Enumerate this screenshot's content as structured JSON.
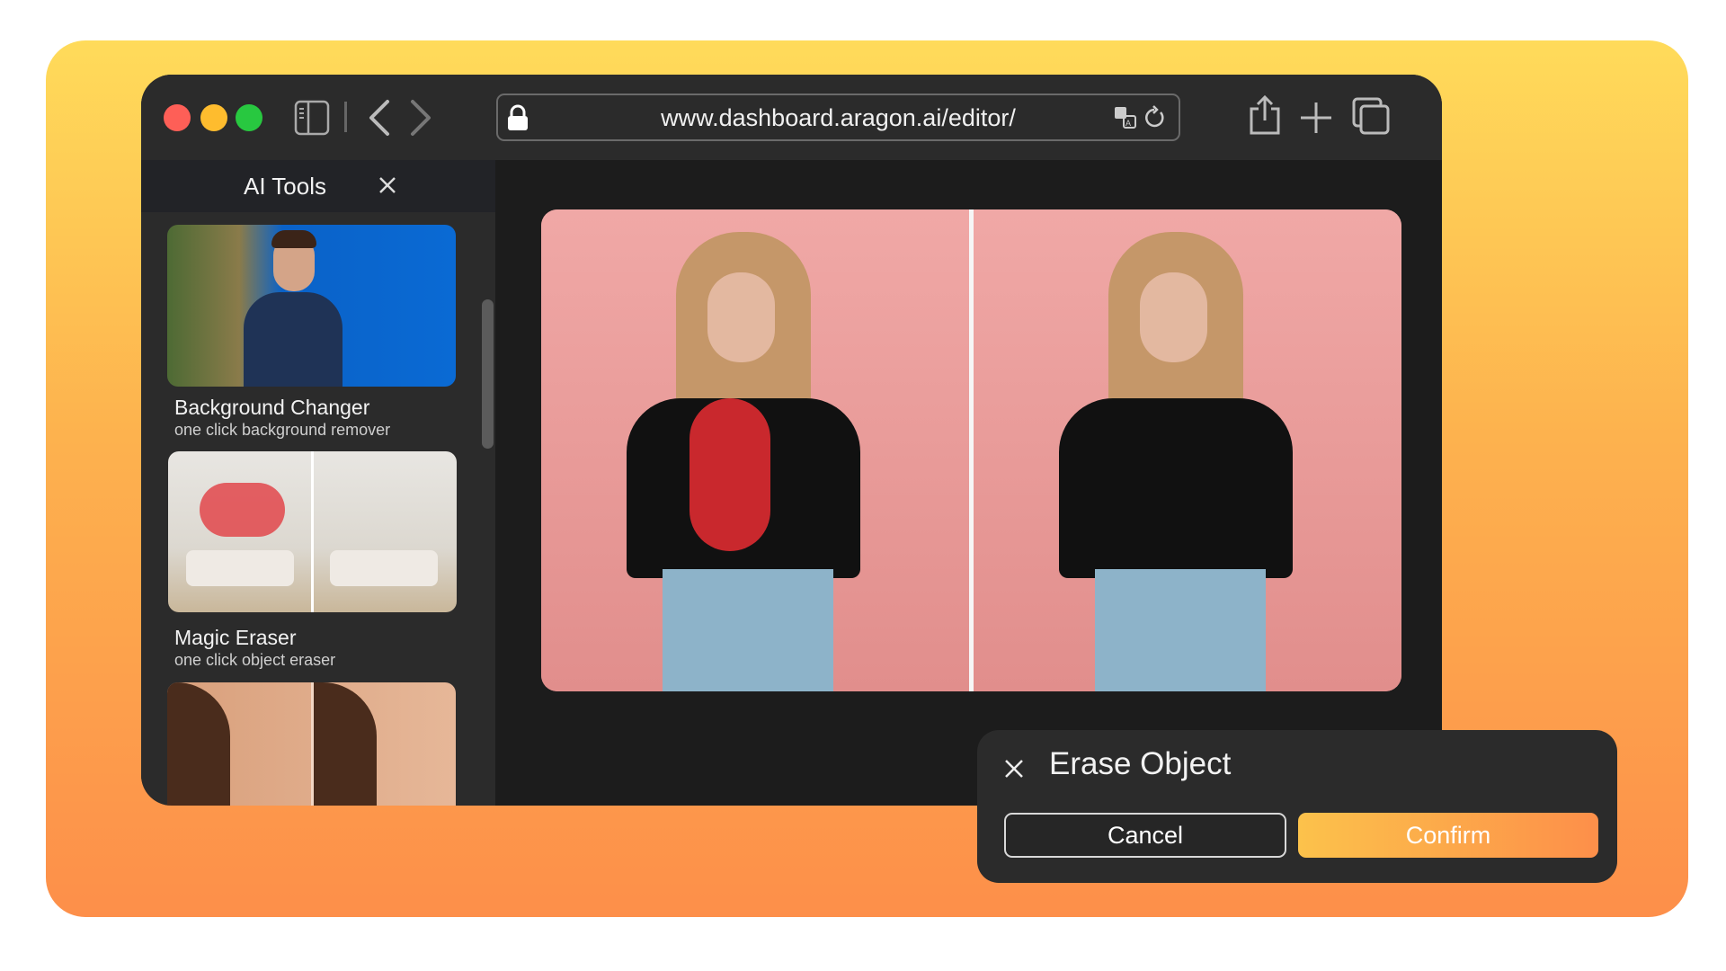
{
  "browser": {
    "url": "www.dashboard.aragon.ai/editor/",
    "traffic_lights": [
      "#fe5f57",
      "#febc2e",
      "#28c840"
    ],
    "icons": [
      "sidebar-icon",
      "back-icon",
      "forward-icon",
      "lock-icon",
      "translate-icon",
      "reload-icon",
      "share-icon",
      "new-tab-icon",
      "tabs-icon"
    ]
  },
  "sidebar": {
    "title": "AI Tools",
    "tools": [
      {
        "title": "Background Changer",
        "subtitle": "one click background remover"
      },
      {
        "title": "Magic Eraser",
        "subtitle": "one click object eraser"
      }
    ]
  },
  "dialog": {
    "title": "Erase Object",
    "cancel_label": "Cancel",
    "confirm_label": "Confirm",
    "accent": "#fd9a4a"
  }
}
